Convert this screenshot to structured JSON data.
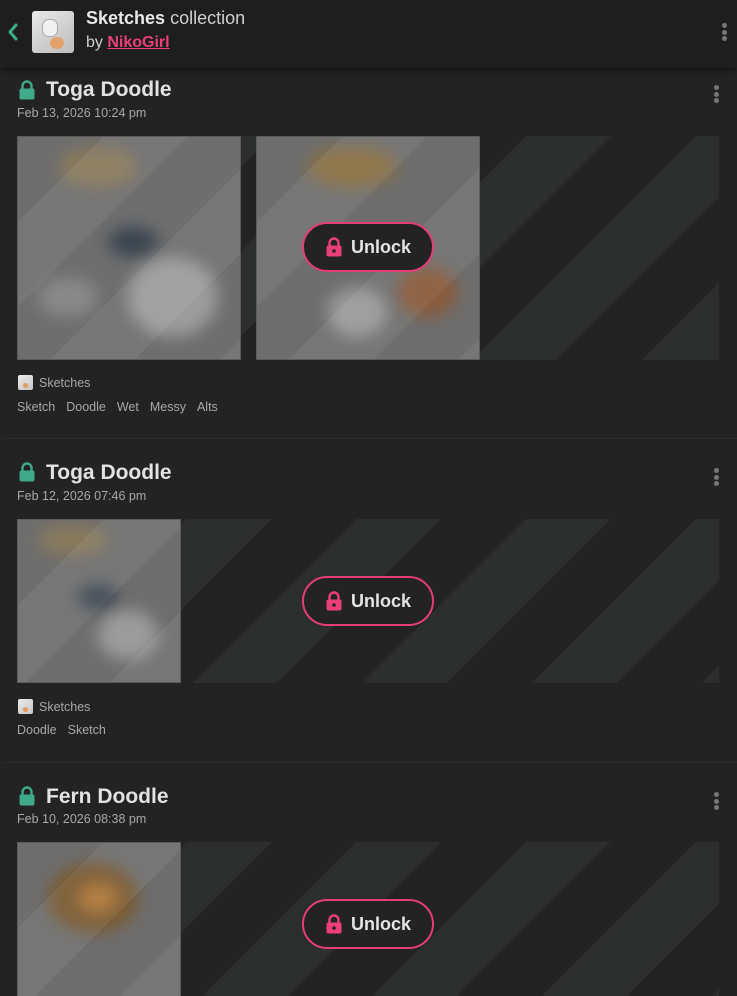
{
  "header": {
    "collection_name": "Sketches",
    "collection_suffix": " collection",
    "by_prefix": "by ",
    "author": "NikoGirl",
    "back_icon": "chevron-left-icon",
    "menu_icon": "kebab-menu-icon"
  },
  "colors": {
    "accent_pink": "#ec3f7a",
    "lock_green": "#3fa98a",
    "background": "#232323"
  },
  "posts": [
    {
      "title": "Toga Doodle",
      "date": "Feb 13, 2026 10:24 pm",
      "unlock_label": "Unlock",
      "collection": "Sketches",
      "tags": [
        "Sketch",
        "Doodle",
        "Wet",
        "Messy",
        "Alts"
      ]
    },
    {
      "title": "Toga Doodle",
      "date": "Feb 12, 2026 07:46 pm",
      "unlock_label": "Unlock",
      "collection": "Sketches",
      "tags": [
        "Doodle",
        "Sketch"
      ]
    },
    {
      "title": "Fern Doodle",
      "date": "Feb 10, 2026 08:38 pm",
      "unlock_label": "Unlock"
    }
  ]
}
